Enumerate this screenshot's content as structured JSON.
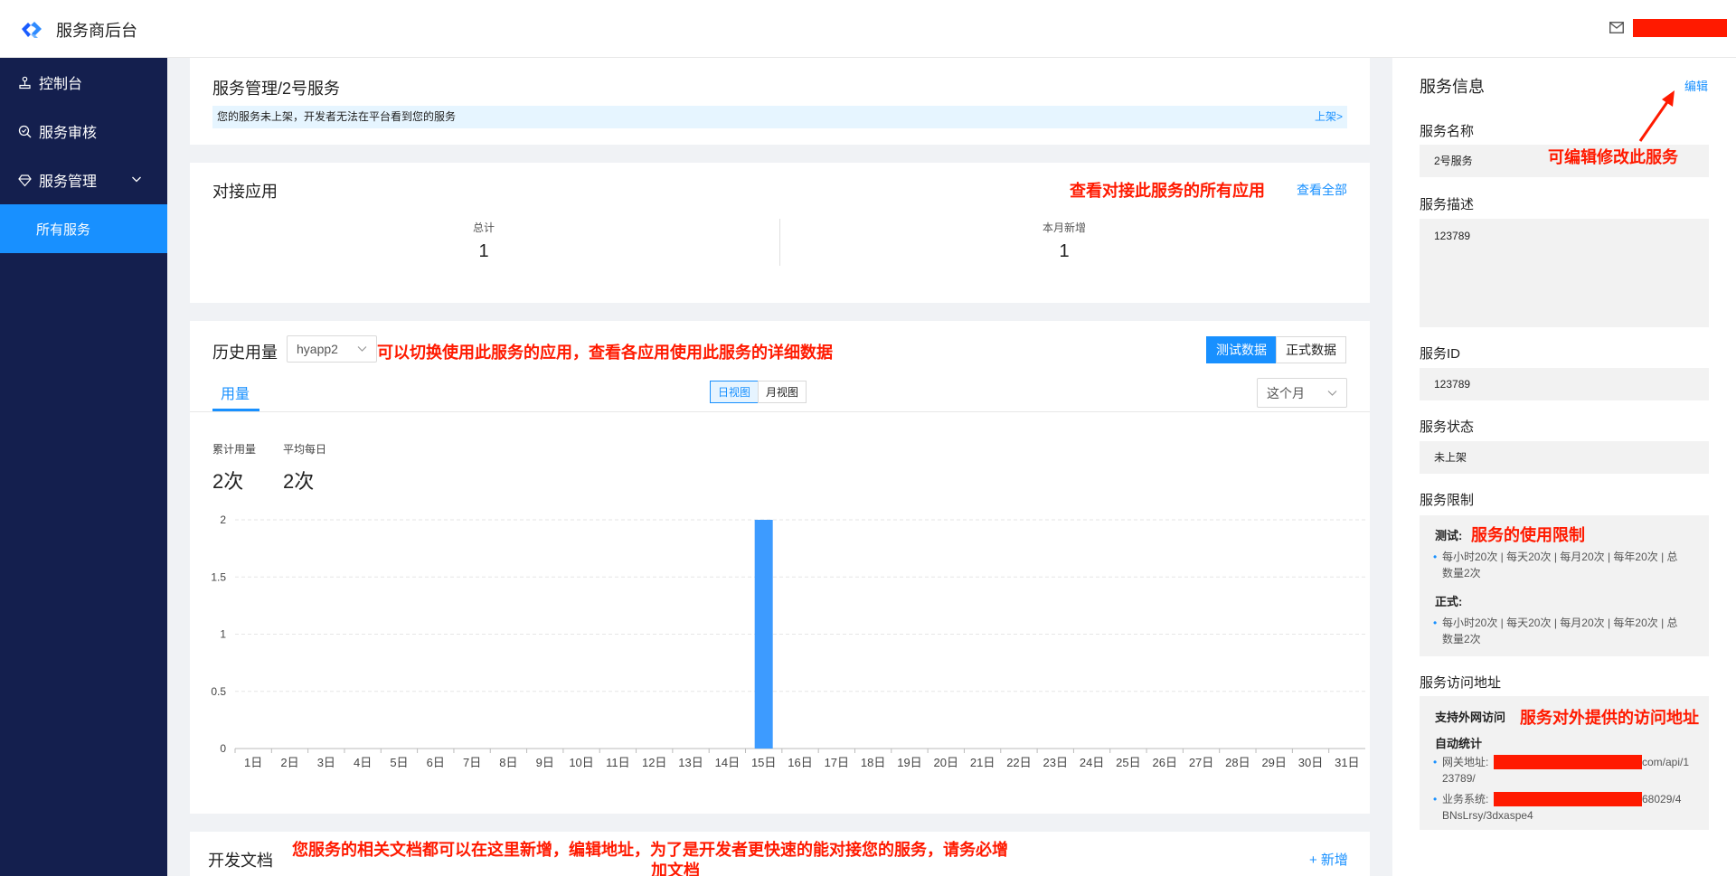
{
  "header": {
    "app_title": "服务商后台"
  },
  "sidebar": {
    "items": [
      {
        "label": "控制台"
      },
      {
        "label": "服务审核"
      },
      {
        "label": "服务管理"
      },
      {
        "label": "所有服务"
      }
    ]
  },
  "service_header": {
    "breadcrumb": "服务管理/2号服务",
    "notice": "您的服务未上架，开发者无法在平台看到您的服务",
    "notice_link": "上架>"
  },
  "connected_apps": {
    "title": "对接应用",
    "annotation": "查看对接此服务的所有应用",
    "view_all": "查看全部",
    "stats": [
      {
        "label": "总计",
        "value": "1"
      },
      {
        "label": "本月新增",
        "value": "1"
      }
    ]
  },
  "usage": {
    "title": "历史用量",
    "app_select": "hyapp2",
    "annotation": "可以切换使用此服务的应用，查看各应用使用此服务的详细数据",
    "data_toggle": [
      "测试数据",
      "正式数据"
    ],
    "tab": "用量",
    "view_toggle": [
      "日视图",
      "月视图"
    ],
    "period_select": "这个月",
    "summary": [
      {
        "label": "累计用量",
        "value": "2次"
      },
      {
        "label": "平均每日",
        "value": "2次"
      }
    ]
  },
  "chart_data": {
    "type": "bar",
    "categories": [
      "1日",
      "2日",
      "3日",
      "4日",
      "5日",
      "6日",
      "7日",
      "8日",
      "9日",
      "10日",
      "11日",
      "12日",
      "13日",
      "14日",
      "15日",
      "16日",
      "17日",
      "18日",
      "19日",
      "20日",
      "21日",
      "22日",
      "23日",
      "24日",
      "25日",
      "26日",
      "27日",
      "28日",
      "29日",
      "30日",
      "31日"
    ],
    "values": [
      0,
      0,
      0,
      0,
      0,
      0,
      0,
      0,
      0,
      0,
      0,
      0,
      0,
      0,
      2,
      0,
      0,
      0,
      0,
      0,
      0,
      0,
      0,
      0,
      0,
      0,
      0,
      0,
      0,
      0,
      0
    ],
    "y_ticks": [
      "0",
      "0.5",
      "1",
      "1.5",
      "2"
    ],
    "ylim": [
      0,
      2
    ],
    "grid": true,
    "bar_color": "#3d9bff"
  },
  "docs": {
    "title": "开发文档",
    "annotation_line1": "您服务的相关文档都可以在这里新增，编辑地址，为了是开发者更快速的能对接您的服务，请务必增",
    "annotation_line2": "加文档",
    "add_button": "+ 新增"
  },
  "service_info": {
    "title": "服务信息",
    "edit": "编辑",
    "edit_annotation": "可编辑修改此服务",
    "name_label": "服务名称",
    "name_value": "2号服务",
    "desc_label": "服务描述",
    "desc_value": "123789",
    "id_label": "服务ID",
    "id_value": "123789",
    "status_label": "服务状态",
    "status_value": "未上架",
    "limit_label": "服务限制",
    "limit_annotation": "服务的使用限制",
    "limit_test_label": "测试:",
    "limit_test_line1": "每小时20次 | 每天20次 | 每月20次 | 每年20次 | 总",
    "limit_test_line2": "数量2次",
    "limit_prod_label": "正式:",
    "limit_prod_line1": "每小时20次 | 每天20次 | 每月20次 | 每年20次 | 总",
    "limit_prod_line2": "数量2次",
    "access_label": "服务访问地址",
    "access_annotation": "服务对外提供的访问地址",
    "external_access": "支持外网访问",
    "auto_stats": "自动统计",
    "gateway_label": "网关地址:",
    "gateway_suffix": "com/api/1",
    "gateway_line2": "23789/",
    "biz_label": "业务系统:",
    "biz_suffix": "68029/4",
    "biz_line2": "BNsLrsy/3dxaspe4"
  },
  "colors": {
    "sidebar_bg": "#141f4e",
    "accent": "#1890ff",
    "annotation": "#ff1a00"
  }
}
